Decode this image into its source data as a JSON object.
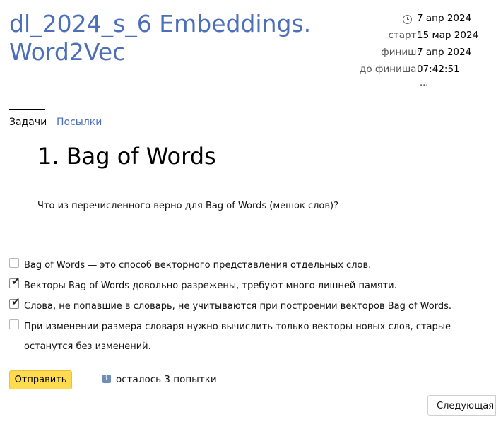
{
  "header": {
    "title": "dl_2024_s_6 Embeddings. Word2Vec",
    "time_now": "7 апр 2024",
    "start_label": "старт:",
    "start_value": "15 мар 2024",
    "finish_label": "финиш:",
    "finish_value": "7 апр 2024",
    "remaining_label": "до финиша:",
    "remaining_value": "07:42:51",
    "ellipsis": "..."
  },
  "tabs": [
    {
      "label": "Задачи",
      "active": true
    },
    {
      "label": "Посылки",
      "active": false
    }
  ],
  "problem": {
    "title": "1. Bag of Words",
    "question": "Что из перечисленного верно для Bag of Words (мешок слов)?",
    "options": [
      {
        "label": "Bag of Words — это способ векторного представления отдельных слов.",
        "checked": false
      },
      {
        "label": "Векторы Bag of Words довольно разрежены, требуют много лишней памяти.",
        "checked": true
      },
      {
        "label": "Слова, не попавшие в словарь, не учитываются при построении векторов Bag of Words.",
        "checked": true
      },
      {
        "label": "При изменении размера словаря нужно вычислить только векторы новых слов, старые останутся без изменений.",
        "checked": false
      }
    ]
  },
  "actions": {
    "submit_label": "Отправить",
    "info_glyph": "i",
    "attempts_text": "осталось 3 попытки",
    "next_label": "Следующая"
  },
  "colors": {
    "link": "#4c6fb9",
    "submit_bg": "#ffdb4d"
  }
}
